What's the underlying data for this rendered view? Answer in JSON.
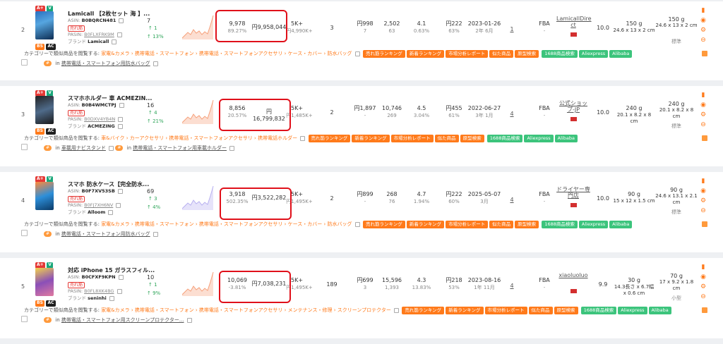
{
  "common": {
    "category_prefix": "カテゴリーで類似商品を閲覧する:",
    "in_label": "in",
    "tags_orange": [
      "売れ筋ランキング",
      "新着ランキング",
      "市場分析レポート",
      "似た商品",
      "原型検索"
    ],
    "tags_green": [
      "1688商品検索",
      "Aliexpress",
      "Alibaba"
    ],
    "asin_label": "ASIN:",
    "parent_label": "PASIN:",
    "brand_label": "ブランド",
    "hot_badge": "売れ筋",
    "badge_aplus": "A+",
    "badge_v": "V",
    "badge_bs": "BS",
    "badge_ac": "AC",
    "fulfillment": "FBA"
  },
  "rows": [
    {
      "num": "2",
      "title": "Lamicall 【2枚セット 海 】...",
      "asin": "B0BQRCN481",
      "parent": "B0FLXFRK9M",
      "brand": "Lamicall",
      "bsr_main": "7",
      "bsr_delta": "↑ 1",
      "bsr_pct": "↑ 13%",
      "sales_units": "9,978",
      "sales_pct": "89.27%",
      "revenue": "円9,958,044",
      "reviews_k": "5K+",
      "reviews_sub": "円4,990K+",
      "variants": "3",
      "price": "円998",
      "price_sub": "7",
      "ratings": "2,502",
      "ratings_sub": "63",
      "score": "4.1",
      "score_sub": "0.63%",
      "fee": "円222",
      "fee_sub": "63%",
      "date": "2023-01-26",
      "date_sub": "2年 6月",
      "sellers": "1",
      "seller": "LamicallDire ct",
      "seller_score": "10.0",
      "weight": "150 g",
      "dims": "24.6 x 13 x 2 cm",
      "weight2": "150 g",
      "dims2": "24.6 x 13 x 2 cm",
      "size_class": "標準",
      "cat_path": "家電&カメラ › 携帯電話・スマートフォン › 携帯電話・スマートフォンアクセサリ › ケース・カバー › 防水バッグ",
      "cat2": "携帯電話・スマートフォン用防水バッグ",
      "badges_bs": true
    },
    {
      "num": "3",
      "title": "スマホホルダー 車 ACMEZIN...",
      "asin": "B0B4WMCTPJ",
      "parent": "B0DXV4YB4N",
      "brand": "ACMEZING",
      "bsr_main": "16",
      "bsr_delta": "↑ 4",
      "bsr_pct": "↑ 21%",
      "sales_units": "8,856",
      "sales_pct": "20.57%",
      "revenue": "円 16,799,832",
      "reviews_k": "5K+",
      "reviews_sub": "円1,485K+",
      "variants": "2",
      "price": "円1,897",
      "price_sub": "-",
      "ratings": "10,746",
      "ratings_sub": "269",
      "score": "4.5",
      "score_sub": "3.04%",
      "fee": "円455",
      "fee_sub": "61%",
      "date": "2022-06-27",
      "date_sub": "3年 1月",
      "sellers": "4",
      "seller": "公式ショップ-JP",
      "seller_score": "10.0",
      "weight": "240 g",
      "dims": "20.1 x 8.2 x 8 cm",
      "weight2": "240 g",
      "dims2": "20.1 x 8.2 x 8 cm",
      "size_class": "標準",
      "cat_path": "車&バイク › カーアクセサリ › 携帯電話・スマートフォンアクセサリ › 携帯電話ホルダー",
      "cat_prefix2": "車載用ナビスタンド",
      "cat2": "携帯電話・スマートフォン用車載ホルダー",
      "badges_bs": true
    },
    {
      "num": "4",
      "title": "スマホ 防水ケース【完全防水...",
      "asin": "B0F7XV53SB",
      "parent": "B0FJ7XH6NV",
      "brand": "Alloom",
      "bsr_main": "69",
      "bsr_delta": "↑ 3",
      "bsr_pct": "↑ 4%",
      "sales_units": "3,918",
      "sales_pct": "502.35%",
      "revenue": "円3,522,282",
      "reviews_k": "5K+",
      "reviews_sub": "円1,495K+",
      "variants": "2",
      "price": "円899",
      "price_sub": "-",
      "ratings": "268",
      "ratings_sub": "76",
      "score": "4.7",
      "score_sub": "1.94%",
      "fee": "円222",
      "fee_sub": "60%",
      "date": "2025-05-07",
      "date_sub": "3月",
      "sellers": "4",
      "seller": "ドライヤー専門店",
      "seller_score": "10.0",
      "weight": "90 g",
      "dims": "15 x 12 x 1.5 cm",
      "weight2": "90 g",
      "dims2": "24.6 x 13.1 x 2.1 cm",
      "size_class": "標準",
      "cat_path": "家電&カメラ › 携帯電話・スマートフォン › 携帯電話・スマートフォンアクセサリ › ケース・カバー › 防水バッグ",
      "cat2": "携帯電話・スマートフォン用防水バッグ",
      "badges_bs": false
    },
    {
      "num": "5",
      "title": "対応 iPhone 15 ガラスフィル...",
      "asin": "B0CFXF9KPN",
      "parent": "B0FL8XK4BG",
      "brand": "seninhi",
      "bsr_main": "10",
      "bsr_delta": "↑ 1",
      "bsr_pct": "↑ 9%",
      "sales_units": "10,069",
      "sales_pct": "-3.81%",
      "revenue": "円7,038,231",
      "reviews_k": "5K+",
      "reviews_sub": "円1,495K+",
      "variants": "189",
      "price": "円699",
      "price_sub": "3",
      "ratings": "15,596",
      "ratings_sub": "1,393",
      "score": "4.3",
      "score_sub": "13.83%",
      "fee": "円218",
      "fee_sub": "53%",
      "date": "2023-08-16",
      "date_sub": "1年 11月",
      "sellers": "4",
      "seller": "xiaoluoluo",
      "seller_score": "9.9",
      "weight": "30 g",
      "dims": "14.3長さ x 6.7幅 x 0.6 cm",
      "weight2": "70 g",
      "dims2": "17 x 9.2 x 1.8 cm",
      "size_class": "小型",
      "cat_path": "家電&カメラ › 携帯電話・スマートフォン › 携帯電話・スマートフォンアクセサリ › メンテナンス・修理 › スクリーンプロテクター",
      "cat2": "携帯電話・スマートフォン用スクリーンプロテクター...",
      "badges_bs": true
    }
  ]
}
